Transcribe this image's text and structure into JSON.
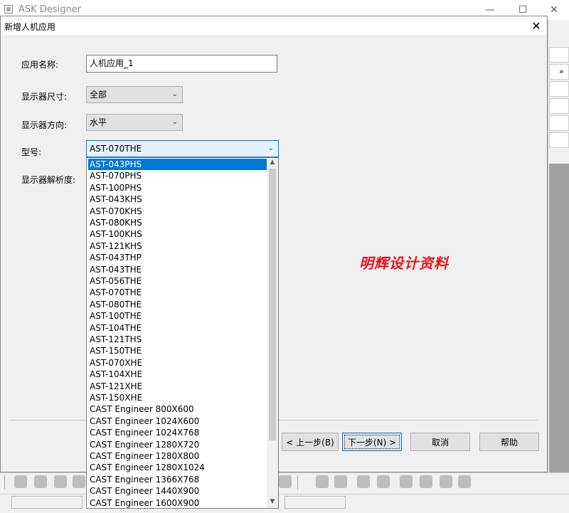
{
  "app": {
    "title": "ASK Designer",
    "minimize": "—",
    "maximize": "☐",
    "close": "✕"
  },
  "dialog": {
    "title": "新增人机应用",
    "close": "✕",
    "fields": {
      "app_name_label": "应用名称:",
      "app_name_value": "人机应用_1",
      "display_size_label": "显示器尺寸:",
      "display_size_value": "全部",
      "display_orientation_label": "显示器方向:",
      "display_orientation_value": "水平",
      "model_label": "型号:",
      "model_value": "AST-070THE",
      "resolution_label": "显示器解析度:"
    },
    "model_options": [
      "AST-043PHS",
      "AST-070PHS",
      "AST-100PHS",
      "AST-043KHS",
      "AST-070KHS",
      "AST-080KHS",
      "AST-100KHS",
      "AST-121KHS",
      "AST-043THP",
      "AST-043THE",
      "AST-056THE",
      "AST-070THE",
      "AST-080THE",
      "AST-100THE",
      "AST-104THE",
      "AST-121THS",
      "AST-150THE",
      "AST-070XHE",
      "AST-104XHE",
      "AST-121XHE",
      "AST-150XHE",
      "CAST Engineer 800X600",
      "CAST Engineer 1024X600",
      "CAST Engineer 1024X768",
      "CAST Engineer 1280X720",
      "CAST Engineer 1280X800",
      "CAST Engineer 1280X1024",
      "CAST Engineer 1366X768",
      "CAST Engineer 1440X900",
      "CAST Engineer 1600X900"
    ],
    "selected_option_index": 0,
    "watermark": "明辉设计资料",
    "buttons": {
      "prev": "< 上一步(B)",
      "next": "下一步(N) >",
      "cancel": "取消",
      "help": "帮助"
    }
  },
  "side_panel": {
    "chevron": "»"
  },
  "colors": {
    "selection": "#0078d7",
    "watermark": "#e8141b",
    "focus_border": "#0078d7"
  }
}
